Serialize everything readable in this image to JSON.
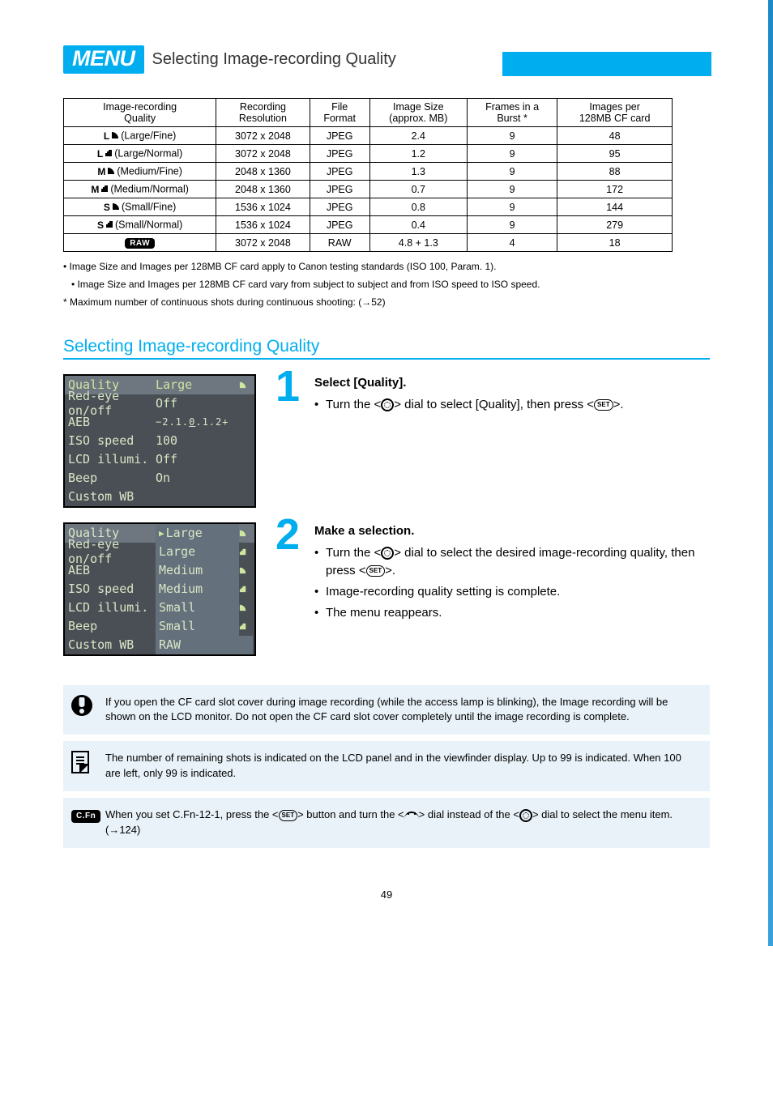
{
  "header": {
    "menu_badge": "MENU",
    "title": "Selecting Image-recording Quality"
  },
  "table": {
    "headers": {
      "quality": "Image-recording\nQuality",
      "resolution": "Recording\nResolution",
      "format": "File\nFormat",
      "size": "Image Size\n(approx. MB)",
      "burst": "Frames in a\nBurst *",
      "shots128": "Images per\n128MB CF card"
    },
    "rows": [
      {
        "prefix": "L",
        "fine": true,
        "quality_sub": "(Large/Fine)",
        "res": "3072 x 2048",
        "fmt": "JPEG",
        "size": "2.4",
        "burst": "9",
        "shots": "48"
      },
      {
        "prefix": "L",
        "fine": false,
        "quality_sub": "(Large/Normal)",
        "res": "3072 x 2048",
        "fmt": "JPEG",
        "size": "1.2",
        "burst": "9",
        "shots": "95"
      },
      {
        "prefix": "M",
        "fine": true,
        "quality_sub": "(Medium/Fine)",
        "res": "2048 x 1360",
        "fmt": "JPEG",
        "size": "1.3",
        "burst": "9",
        "shots": "88"
      },
      {
        "prefix": "M",
        "fine": false,
        "quality_sub": "(Medium/Normal)",
        "res": "2048 x 1360",
        "fmt": "JPEG",
        "size": "0.7",
        "burst": "9",
        "shots": "172"
      },
      {
        "prefix": "S",
        "fine": true,
        "quality_sub": "(Small/Fine)",
        "res": "1536 x 1024",
        "fmt": "JPEG",
        "size": "0.8",
        "burst": "9",
        "shots": "144"
      },
      {
        "prefix": "S",
        "fine": false,
        "quality_sub": "(Small/Normal)",
        "res": "1536 x 1024",
        "fmt": "JPEG",
        "size": "0.4",
        "burst": "9",
        "shots": "279"
      },
      {
        "prefix": "RAW",
        "raw": true,
        "quality_sub": "",
        "res": "3072 x 2048",
        "fmt": "RAW",
        "size": "4.8 + 1.3",
        "burst": "4",
        "shots": "18"
      }
    ],
    "footnote1": "• Image Size and Images per 128MB CF card apply to Canon testing standards (ISO 100, Param. 1).",
    "footnote2": "• Image Size and Images per 128MB CF card vary from subject to subject and from ISO speed to ISO speed.",
    "footnote3_prefix": "* Maximum number of continuous shots during continuous shooting:",
    "footnote3_ref": "(→52)"
  },
  "section_heading": "Selecting Image-recording Quality",
  "lcd1": {
    "rows": [
      {
        "label": "Quality",
        "value": "Large",
        "icon": "fine",
        "hl": true
      },
      {
        "label": "Red-eye on/off",
        "value": "Off"
      },
      {
        "label": "AEB",
        "value": "−2.1.0.1.2+",
        "aeb": true
      },
      {
        "label": "ISO speed",
        "value": "100"
      },
      {
        "label": "LCD illumi.",
        "value": "Off"
      },
      {
        "label": "Beep",
        "value": "On"
      },
      {
        "label": "Custom WB",
        "value": ""
      }
    ]
  },
  "lcd2": {
    "rows_left": [
      "Quality",
      "Red-eye on/off",
      "AEB",
      "ISO speed",
      "LCD illumi.",
      "Beep",
      "Custom WB"
    ],
    "rows_right": [
      {
        "label": "Large",
        "icon": "fine",
        "sel": true
      },
      {
        "label": "Large",
        "icon": "normal"
      },
      {
        "label": "Medium",
        "icon": "fine"
      },
      {
        "label": "Medium",
        "icon": "normal"
      },
      {
        "label": "Small",
        "icon": "fine"
      },
      {
        "label": "Small",
        "icon": "normal"
      },
      {
        "label": "RAW",
        "icon": ""
      }
    ]
  },
  "step1": {
    "title": "Select [Quality].",
    "b1_pre": "Turn the <",
    "b1_post": "> dial to select [Quality], then press <",
    "b1_end": ">."
  },
  "step2": {
    "title": "Make a selection.",
    "b1_pre": "Turn the <",
    "b1_mid": "> dial to select the desired image-recording quality, then press <",
    "b1_end": ">.",
    "b2": "Image-recording quality setting is complete.",
    "b3": "The menu reappears."
  },
  "noteA": "If you open the CF card slot cover during image recording (while the access lamp is blinking), the Image recording will be shown on the LCD monitor. Do not open the CF card slot cover completely until the image recording is complete.",
  "noteB": "The number of remaining shots is indicated on the LCD panel and in the viewfinder display. Up to 99 is indicated. When 100 are left, only 99 is indicated.",
  "noteC_before": "When you set C.Fn-12-1, press the <",
  "noteC_mid": "> button and turn the <",
  "noteC_mid2": "> dial instead of the <",
  "noteC_end": "> dial to select the menu item.",
  "noteC_ref": "(→124)",
  "cfn_label": "C.Fn",
  "page_number": "49"
}
